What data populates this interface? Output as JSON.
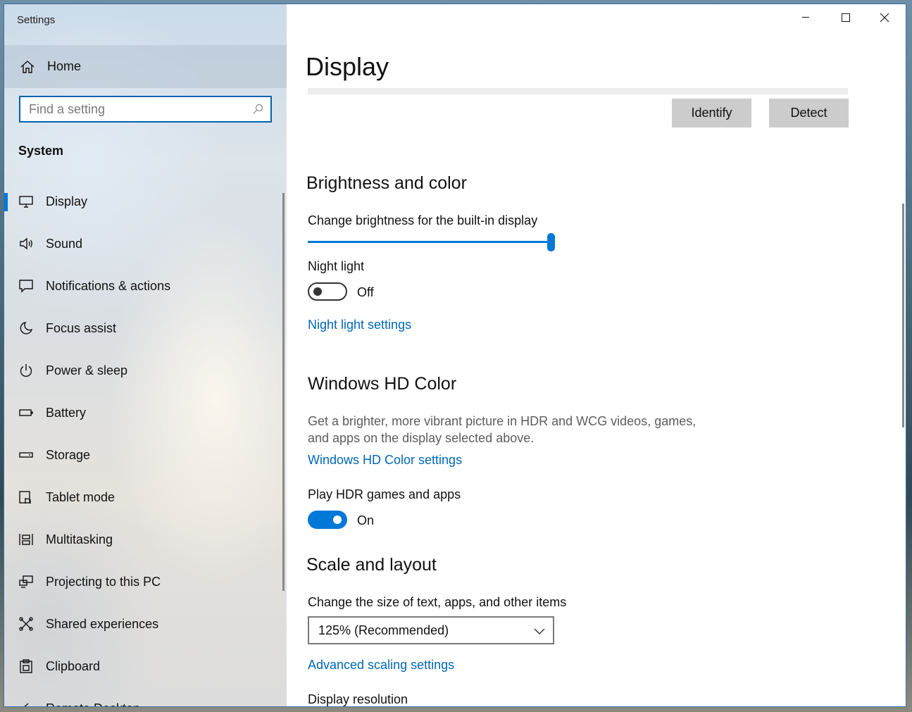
{
  "window": {
    "title": "Settings"
  },
  "sidebar": {
    "home_label": "Home",
    "search_placeholder": "Find a setting",
    "section": "System",
    "items": [
      {
        "label": "Display",
        "icon": "monitor-icon",
        "active": true
      },
      {
        "label": "Sound",
        "icon": "speaker-icon"
      },
      {
        "label": "Notifications & actions",
        "icon": "notification-icon"
      },
      {
        "label": "Focus assist",
        "icon": "moon-icon"
      },
      {
        "label": "Power & sleep",
        "icon": "power-icon"
      },
      {
        "label": "Battery",
        "icon": "battery-icon"
      },
      {
        "label": "Storage",
        "icon": "storage-icon"
      },
      {
        "label": "Tablet mode",
        "icon": "tablet-mode-icon"
      },
      {
        "label": "Multitasking",
        "icon": "multitasking-icon"
      },
      {
        "label": "Projecting to this PC",
        "icon": "projecting-icon"
      },
      {
        "label": "Shared experiences",
        "icon": "shared-experiences-icon"
      },
      {
        "label": "Clipboard",
        "icon": "clipboard-icon"
      },
      {
        "label": "Remote Desktop",
        "icon": "remote-desktop-icon"
      }
    ]
  },
  "main": {
    "page_title": "Display",
    "identify_label": "Identify",
    "detect_label": "Detect",
    "brightness": {
      "heading": "Brightness and color",
      "slider_label": "Change brightness for the built-in display",
      "value_percent": 100
    },
    "night_light": {
      "label": "Night light",
      "state": "Off",
      "settings_link": "Night light settings"
    },
    "hd_color": {
      "heading": "Windows HD Color",
      "description_line1": "Get a brighter, more vibrant picture in HDR and WCG videos, games,",
      "description_line2": "and apps on the display selected above.",
      "settings_link": "Windows HD Color settings",
      "hdr_label": "Play HDR games and apps",
      "hdr_state": "On"
    },
    "scale": {
      "heading": "Scale and layout",
      "size_label": "Change the size of text, apps, and other items",
      "size_value": "125% (Recommended)",
      "advanced_link": "Advanced scaling settings",
      "resolution_label": "Display resolution"
    }
  },
  "colors": {
    "accent": "#0078d7",
    "link": "#0067b8"
  }
}
